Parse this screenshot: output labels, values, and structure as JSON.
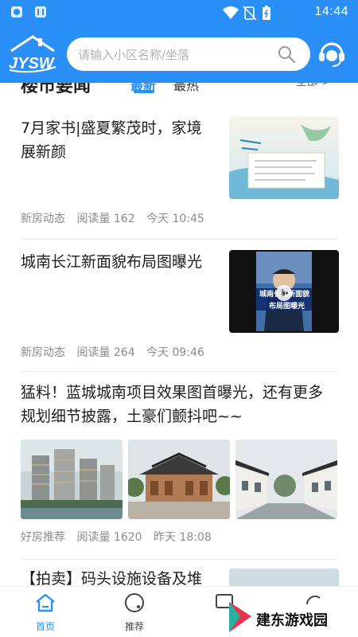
{
  "status_bar": {
    "time": "14:44",
    "icons": [
      "shield-icon",
      "a-icon",
      "wifi-icon",
      "no-sim-icon",
      "battery-icon"
    ]
  },
  "header": {
    "logo_text": "JYSW",
    "search_placeholder": "请输入小区名称/坐落",
    "accent_color": "#2a8ff7"
  },
  "section": {
    "title": "楼市要闻",
    "tabs": [
      {
        "label": "最新",
        "active": true
      },
      {
        "label": "最热",
        "active": false
      }
    ],
    "more_label": "全部 >"
  },
  "feed": {
    "items": [
      {
        "title": "7月家书|盛夏繁茂时，家境展新颜",
        "category": "新房动态",
        "reads": "阅读量 162",
        "time": "今天 10:45",
        "thumb": "letter-illustration"
      },
      {
        "title": "城南长江新面貌布局图曝光",
        "category": "新房动态",
        "reads": "阅读量 264",
        "time": "今天 09:46",
        "thumb": "video-thumbnail",
        "thumb_caption_1": "城南长江新面貌",
        "thumb_caption_2": "布局图曝光"
      },
      {
        "title": "猛料！蓝城城南项目效果图首曝光，还有更多规划细节披露，土豪们颤抖吧~~",
        "category": "好房推荐",
        "reads": "阅读量 1620",
        "time": "昨天 18:08",
        "thumbs": [
          "modern-towers",
          "chinese-mansion",
          "chinese-street"
        ]
      },
      {
        "title": "【拍卖】码头设施设备及堆"
      }
    ]
  },
  "bottom_nav": {
    "items": [
      {
        "label": "首页",
        "icon": "home-icon",
        "active": true
      },
      {
        "label": "推荐",
        "icon": "compass-icon",
        "active": false
      },
      {
        "label": "",
        "icon": "square-icon",
        "active": false
      },
      {
        "label": "",
        "icon": "user-icon",
        "active": false
      }
    ]
  },
  "watermark": {
    "text": "建东游戏园"
  }
}
